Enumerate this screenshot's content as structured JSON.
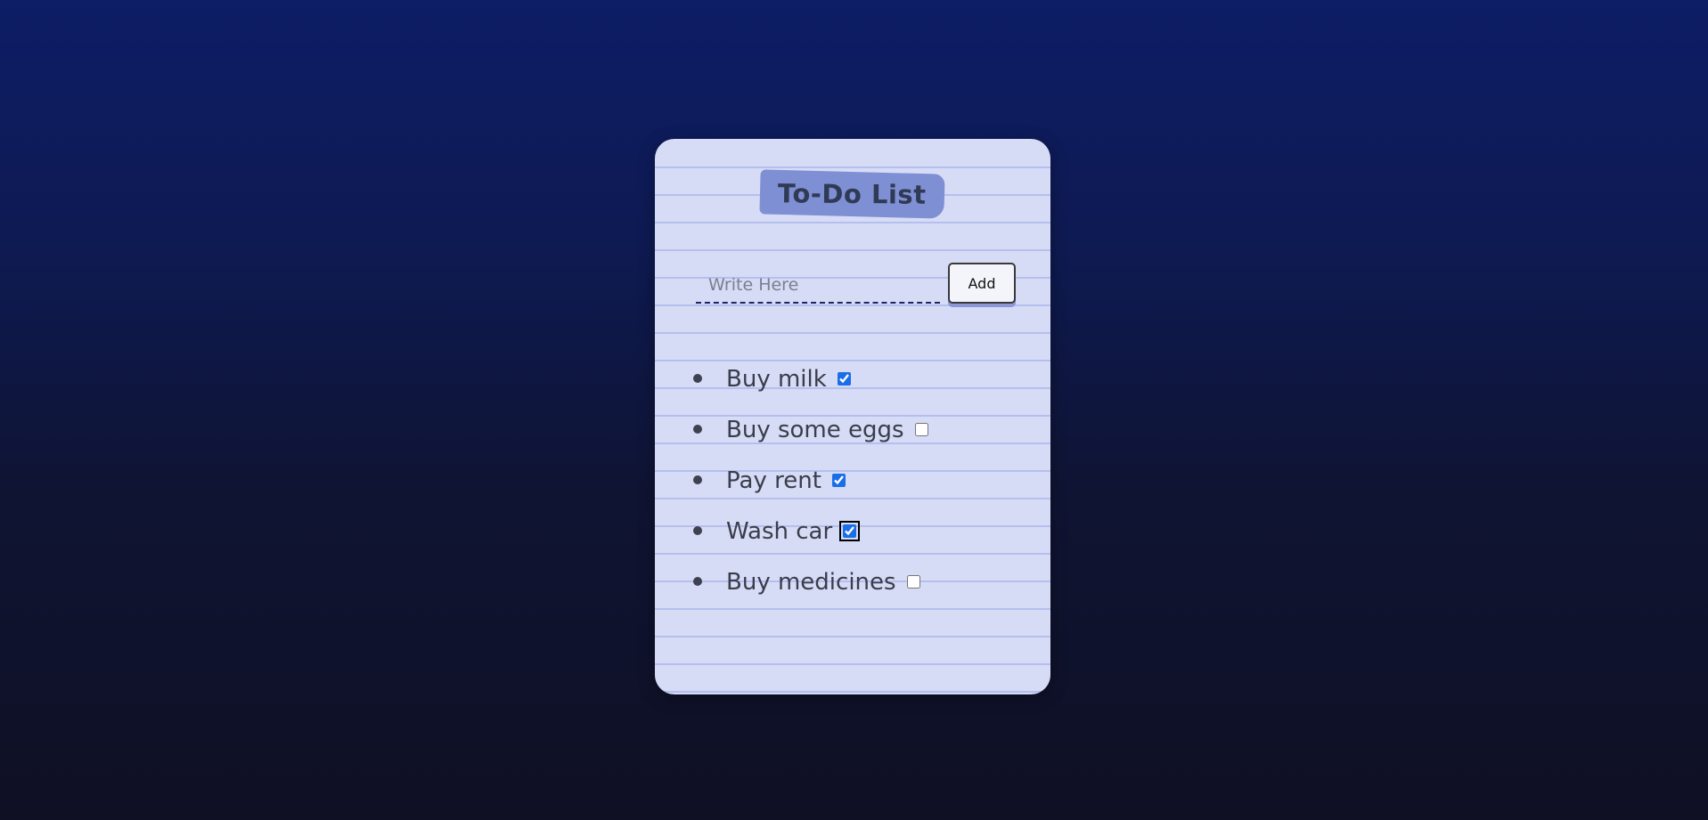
{
  "app": {
    "title": "To-Do List"
  },
  "input": {
    "placeholder": "Write Here",
    "value": ""
  },
  "add_button": {
    "label": "Add"
  },
  "todos": [
    {
      "text": "Buy milk",
      "done": true,
      "focused": false
    },
    {
      "text": "Buy some eggs",
      "done": false,
      "focused": false
    },
    {
      "text": "Pay rent",
      "done": true,
      "focused": false
    },
    {
      "text": "Wash car",
      "done": true,
      "focused": true
    },
    {
      "text": "Buy medicines",
      "done": false,
      "focused": false
    }
  ],
  "colors": {
    "background_top": "#0d1d66",
    "background_bottom": "#0f1024",
    "card": "#d6dbf6",
    "title_badge": "#7f8fd3",
    "checkbox_accent": "#1a6fe8"
  }
}
